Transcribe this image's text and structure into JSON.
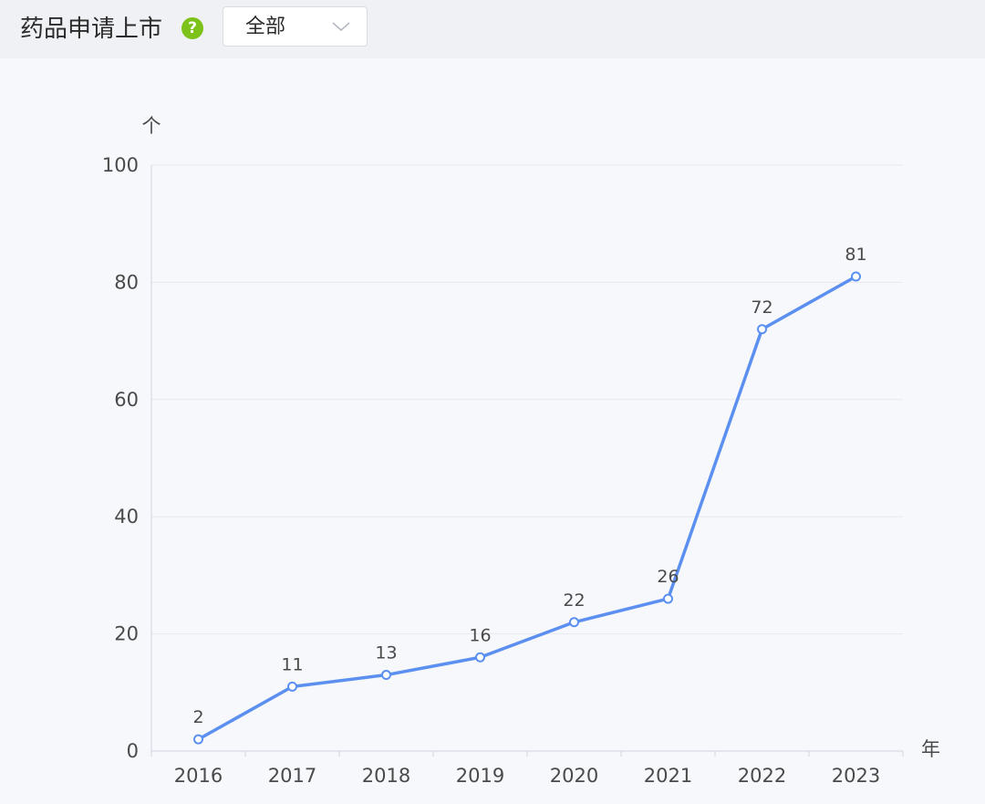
{
  "header": {
    "title": "药品申请上市",
    "help_icon": "question-circle-icon",
    "help_glyph": "?",
    "filter": {
      "selected": "全部",
      "icon": "chevron-down-icon"
    }
  },
  "colors": {
    "line": "#5b8ff0",
    "help_icon": "#7cc218",
    "grid": "#e6e8ee",
    "axis": "#cfd3dc"
  },
  "chart_data": {
    "type": "line",
    "title": "药品申请上市",
    "x": [
      "2016",
      "2017",
      "2018",
      "2019",
      "2020",
      "2021",
      "2022",
      "2023"
    ],
    "series": [
      {
        "values": [
          2,
          11,
          13,
          16,
          22,
          26,
          72,
          81
        ]
      }
    ],
    "xlabel": "年",
    "ylabel": "个",
    "ylim": [
      0,
      100
    ],
    "yticks": [
      0,
      20,
      40,
      60,
      80,
      100
    ],
    "grid": true,
    "data_labels": true,
    "legend": "none"
  }
}
